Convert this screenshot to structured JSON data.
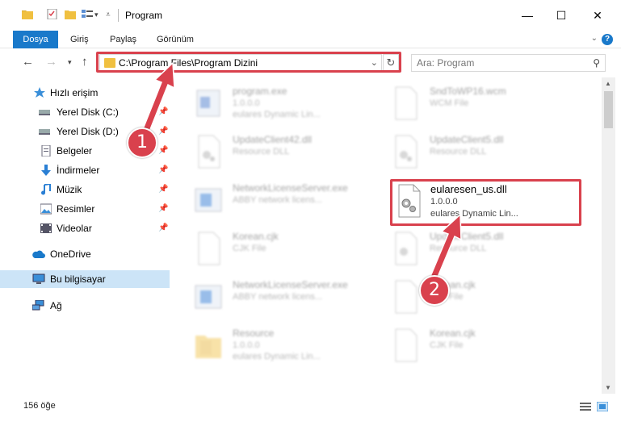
{
  "window": {
    "title": "Program",
    "controls": [
      "—",
      "☐",
      "✕"
    ]
  },
  "ribbon": {
    "tabs": [
      "Dosya",
      "Giriş",
      "Paylaş",
      "Görünüm"
    ],
    "collapse": "⌄",
    "help": "?"
  },
  "nav": {
    "address": "C:\\Program Files\\Program Dizini",
    "search_placeholder": "Ara: Program"
  },
  "sidebar": {
    "items": [
      {
        "label": "Hızlı erişim",
        "icon": "star-icon"
      },
      {
        "label": "Yerel Disk (C:)",
        "icon": "drive-icon"
      },
      {
        "label": "Yerel Disk (D:)",
        "icon": "drive-icon"
      },
      {
        "label": "Belgeler",
        "icon": "documents-icon"
      },
      {
        "label": "İndirmeler",
        "icon": "download-icon"
      },
      {
        "label": "Müzik",
        "icon": "music-icon"
      },
      {
        "label": "Resimler",
        "icon": "pictures-icon"
      },
      {
        "label": "Videolar",
        "icon": "videos-icon"
      },
      {
        "label": "OneDrive",
        "icon": "cloud-icon"
      },
      {
        "label": "Bu bilgisayar",
        "icon": "computer-icon"
      },
      {
        "label": "Ağ",
        "icon": "network-icon"
      }
    ]
  },
  "files": [
    {
      "name": "program.exe",
      "sub1": "1.0.0.0",
      "sub2": "eulares Dynamic Lin..."
    },
    {
      "name": "SndToWP16.wcm",
      "sub1": "WCM File",
      "sub2": ""
    },
    {
      "name": "UpdateClient42.dll",
      "sub1": "Resource DLL",
      "sub2": ""
    },
    {
      "name": "UpdateClient5.dll",
      "sub1": "Resource DLL",
      "sub2": ""
    },
    {
      "name": "NetworkLicenseServer.exe",
      "sub1": "ABBY network licens...",
      "sub2": ""
    },
    {
      "name": "eularesen_us.dll",
      "sub1": "1.0.0.0",
      "sub2": "eulares Dynamic Lin..."
    },
    {
      "name": "Korean.cjk",
      "sub1": "CJK File",
      "sub2": ""
    },
    {
      "name": "UpdateClient5.dll",
      "sub1": "Resource DLL",
      "sub2": ""
    },
    {
      "name": "NetworkLicenseServer.exe",
      "sub1": "ABBY network licens...",
      "sub2": ""
    },
    {
      "name": "Korean.cjk",
      "sub1": "CJK File",
      "sub2": ""
    },
    {
      "name": "Resource",
      "sub1": "1.0.0.0",
      "sub2": "eulares Dynamic Lin..."
    },
    {
      "name": "Korean.cjk",
      "sub1": "CJK File",
      "sub2": ""
    }
  ],
  "status": {
    "count": "156 öğe"
  },
  "annotations": {
    "step1": "1",
    "step2": "2",
    "color": "#d9414d"
  }
}
